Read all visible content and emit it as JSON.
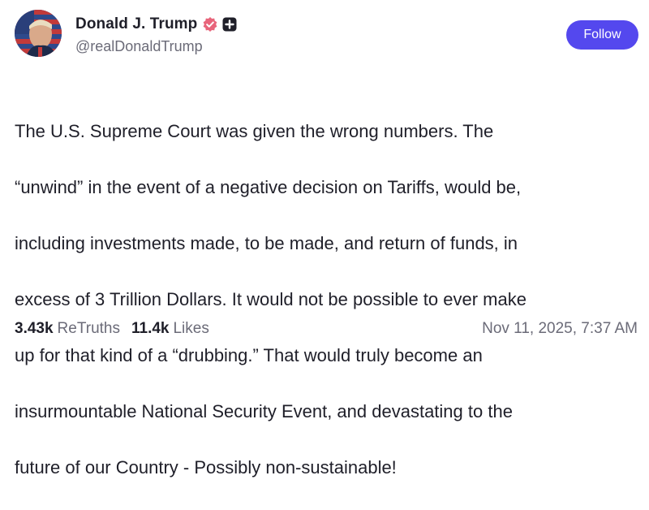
{
  "author": {
    "display_name": "Donald J. Trump",
    "handle": "@realDonaldTrump",
    "verified_icon": "verified-badge-icon",
    "extra_badge_icon": "plus-badge-icon"
  },
  "actions": {
    "follow_label": "Follow"
  },
  "post": {
    "lines": [
      "The U.S. Supreme Court was given the wrong numbers. The",
      "“unwind” in the event of a negative decision on Tariffs, would be,",
      "including investments made, to be made, and return of funds, in",
      "excess of 3 Trillion Dollars. It would not be possible to ever make",
      "up for that kind of a “drubbing.” That would truly become an",
      "insurmountable National Security Event, and devastating to the",
      "future of our Country - Possibly non-sustainable!"
    ]
  },
  "stats": {
    "retruths_count": "3.43k",
    "retruths_label": "ReTruths",
    "likes_count": "11.4k",
    "likes_label": "Likes"
  },
  "timestamp": "Nov 11, 2025, 7:37 AM",
  "colors": {
    "follow_button": "#5448ee",
    "verified_badge": "#e8657b",
    "text_primary": "#1f1f29",
    "text_secondary": "#6b6b78"
  }
}
